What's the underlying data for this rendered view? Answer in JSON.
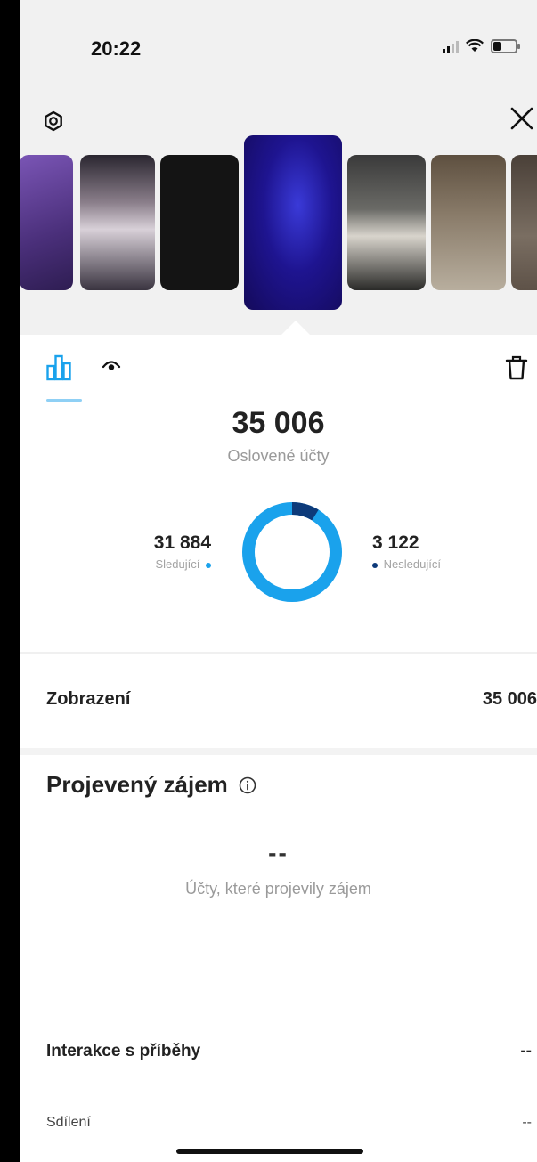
{
  "status_bar": {
    "time": "20:22"
  },
  "stories": [
    {
      "label": "",
      "color": "#5a3a8a"
    },
    {
      "label": "",
      "color": "#7a6878"
    },
    {
      "label": "",
      "color": "#141414"
    },
    {
      "label": "",
      "color": "#1a1070"
    },
    {
      "label": "",
      "color": "#4a4a4a"
    },
    {
      "label": "",
      "color": "#7b6e5e"
    },
    {
      "label": "",
      "color": "#5e5248"
    }
  ],
  "tabs": {
    "insights_icon": "bar-chart-icon",
    "views_icon": "eye-icon"
  },
  "reach": {
    "value": "35 006",
    "label": "Oslovené účty",
    "followers_value": "31 884",
    "followers_label": "Sledující",
    "followers_color": "#1aa2ec",
    "nonfollowers_value": "3 122",
    "nonfollowers_label": "Nesledující",
    "nonfollowers_color": "#0d3a7a",
    "nonfollowers_fraction": 0.089
  },
  "impressions": {
    "label": "Zobrazení",
    "value": "35 006"
  },
  "interest": {
    "title": "Projevený zájem",
    "value": "--",
    "label": "Účty, které projevily zájem"
  },
  "interactions": {
    "title": "Interakce s příběhy",
    "title_value": "--",
    "shares_label": "Sdílení",
    "shares_value": "--"
  }
}
